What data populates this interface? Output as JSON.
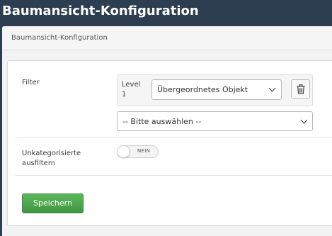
{
  "header": {
    "title": "Baumansicht-Konfiguration"
  },
  "panel": {
    "title": "Baumansicht-Konfiguration"
  },
  "form": {
    "filter": {
      "label": "Filter",
      "level_label": "Level 1",
      "parent_select_value": "Übergeordnetes Objekt",
      "choose_select_value": "-- Bitte auswählen --"
    },
    "uncategorized": {
      "label": "Unkategorisierte ausfiltern",
      "toggle_text": "NEIN",
      "enabled": false
    },
    "save_label": "Speichern"
  },
  "icons": {
    "delete": "trash-icon",
    "dropdown": "chevron-down-icon"
  },
  "colors": {
    "header_bg": "#2d3e50",
    "save_button": "#5cb85c",
    "panel_bg": "#f2f2f2"
  }
}
